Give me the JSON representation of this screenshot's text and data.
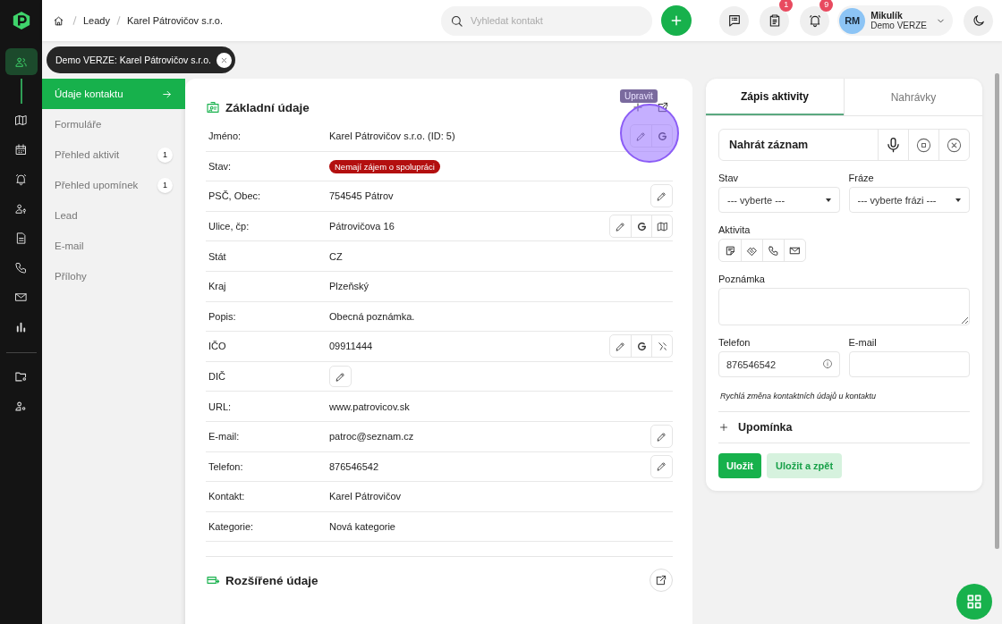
{
  "rail": {
    "top": [
      {
        "kind": "users",
        "selected": true
      },
      {
        "kind": "map",
        "selected": false
      },
      {
        "kind": "calendar",
        "selected": false
      },
      {
        "kind": "bell",
        "selected": false
      },
      {
        "kind": "userkey",
        "selected": false
      },
      {
        "kind": "doc",
        "selected": false
      },
      {
        "kind": "phone",
        "selected": false
      },
      {
        "kind": "mail",
        "selected": false
      },
      {
        "kind": "chart",
        "selected": false
      }
    ],
    "bottom": [
      {
        "kind": "foldergear",
        "selected": false
      },
      {
        "kind": "usergear",
        "selected": false
      }
    ]
  },
  "breadcrumb": [
    "Leady",
    "Karel Pátrovičov s.r.o."
  ],
  "search": {
    "placeholder": "Vyhledat kontakt"
  },
  "top_buttons": [
    {
      "kind": "chat"
    },
    {
      "kind": "clipboard",
      "badge": "1"
    },
    {
      "kind": "bell",
      "badge": "9"
    }
  ],
  "user": {
    "initials": "RM",
    "name": "Mikulík",
    "org": "Demo VERZE"
  },
  "open_tab": {
    "label": "Demo VERZE: Karel Pátrovičov s.r.o."
  },
  "submenu": [
    {
      "label": "Údaje kontaktu",
      "selected": true
    },
    {
      "label": "Formuláře",
      "selected": false
    },
    {
      "label": "Přehled aktivit",
      "selected": false,
      "count": "1"
    },
    {
      "label": "Přehled upomínek",
      "selected": false,
      "count": "1"
    },
    {
      "label": "Lead",
      "selected": false
    },
    {
      "label": "E-mail",
      "selected": false
    },
    {
      "label": "Přílohy",
      "selected": false
    }
  ],
  "basic": {
    "title": "Základní údaje",
    "rows": [
      {
        "label": "Jméno:",
        "kind": "text",
        "value": "Karel Pátrovičov s.r.o. (ID: 5)",
        "actions": [
          {
            "kind": "edit"
          },
          {
            "kind": "google"
          }
        ],
        "tooltip": "Upravit"
      },
      {
        "label": "Stav:",
        "kind": "badge",
        "value": "Nemají zájem o spolupráci",
        "color": "#b30f0f"
      },
      {
        "label": "PSČ, Obec:",
        "kind": "text",
        "value": "754545 Pátrov",
        "actions": [
          {
            "kind": "edit"
          }
        ]
      },
      {
        "label": "Ulice, čp:",
        "kind": "text",
        "value": "Pátrovičova 16",
        "actions": [
          {
            "kind": "edit"
          },
          {
            "kind": "google"
          },
          {
            "kind": "map"
          }
        ]
      },
      {
        "label": "Stát",
        "kind": "text",
        "value": "CZ"
      },
      {
        "label": "Kraj",
        "kind": "text",
        "value": "Plzeňský"
      },
      {
        "label": "Popis:",
        "kind": "text",
        "value": "Obecná poznámka."
      },
      {
        "label": "IČO",
        "kind": "text",
        "value": "09911444",
        "actions": [
          {
            "kind": "edit"
          },
          {
            "kind": "google"
          },
          {
            "kind": "register"
          }
        ]
      },
      {
        "label": "DIČ",
        "kind": "button"
      },
      {
        "label": "URL:",
        "kind": "text",
        "value": "www.patrovicov.sk"
      },
      {
        "label": "E-mail:",
        "kind": "text",
        "value": "patroc@seznam.cz",
        "actions": [
          {
            "kind": "edit"
          }
        ]
      },
      {
        "label": "Telefon:",
        "kind": "text",
        "value": "876546542",
        "actions": [
          {
            "kind": "edit"
          }
        ]
      },
      {
        "label": "Kontakt:",
        "kind": "text",
        "value": "Karel Pátrovičov"
      },
      {
        "label": "Kategorie:",
        "kind": "text",
        "value": "Nová kategorie"
      }
    ]
  },
  "extended": {
    "title": "Rozšířené údaje"
  },
  "activity": {
    "tabs": [
      {
        "label": "Zápis aktivity",
        "selected": true
      },
      {
        "label": "Nahrávky",
        "selected": false
      }
    ],
    "record": "Nahrát záznam",
    "stav": {
      "label": "Stav",
      "value": "--- vyberte ---"
    },
    "fraze": {
      "label": "Fráze",
      "value": "--- vyberte frázi ---"
    },
    "activity_label": "Aktivita",
    "note_label": "Poznámka",
    "phone": {
      "label": "Telefon",
      "value": "876546542"
    },
    "email": {
      "label": "E-mail"
    },
    "hint": "Rychlá změna kontaktních údajů u kontaktu",
    "reminder": "Upomínka",
    "save": "Uložit",
    "save_back": "Uložit a zpět"
  }
}
